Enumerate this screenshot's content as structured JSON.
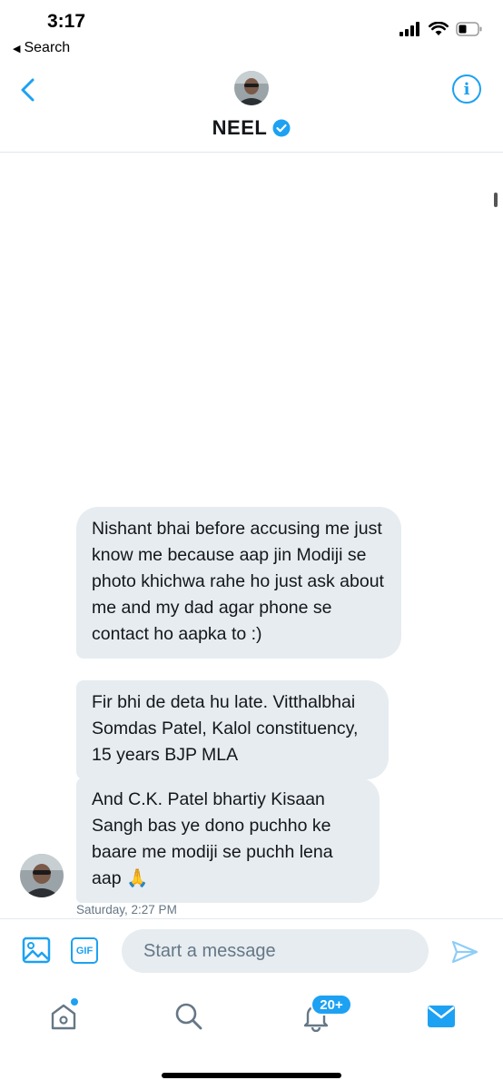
{
  "status_bar": {
    "time": "3:17",
    "back_app": "Search",
    "icons": [
      "signal-icon",
      "wifi-icon",
      "battery-icon"
    ]
  },
  "header": {
    "name": "NEEL",
    "verified": true,
    "back_icon": "chevron-left-icon",
    "info_icon": "info-icon"
  },
  "messages": [
    {
      "text": "Nishant bhai before accusing me just know me because aap jin Modiji se photo khichwa rahe ho just ask about me and my dad agar phone se contact ho aapka to :)"
    },
    {
      "text": "Fir bhi de deta hu late. Vitthalbhai Somdas Patel, Kalol constituency, 15 years BJP MLA"
    },
    {
      "text": "And C.K. Patel bhartiy Kisaan Sangh bas ye dono puchho ke baare me modiji se puchh lena aap 🙏"
    }
  ],
  "timestamp": "Saturday, 2:27 PM",
  "composer": {
    "placeholder": "Start a message",
    "gif_label": "GIF"
  },
  "tabbar": {
    "notifications_badge": "20+"
  },
  "colors": {
    "accent": "#1da1f2",
    "bubble": "#e6ecf0",
    "muted": "#657786"
  }
}
